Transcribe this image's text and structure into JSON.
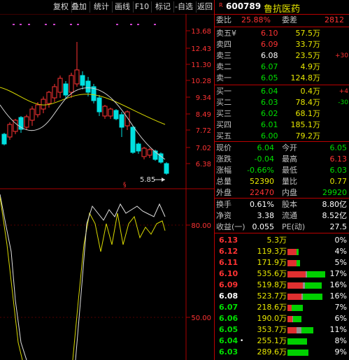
{
  "toolbar": {
    "buttons": [
      {
        "label": "复权"
      },
      {
        "label": "叠加"
      },
      {
        "label": "统计"
      },
      {
        "label": "画线"
      },
      {
        "label": "F10"
      },
      {
        "label": "标记"
      },
      {
        "label": "-自选"
      },
      {
        "label": "返回"
      }
    ]
  },
  "stock": {
    "badge": "R",
    "code": "600789",
    "name": "鲁抗医药"
  },
  "chart": {
    "price_ticks": [
      "13.68",
      "12.43",
      "11.30",
      "10.28",
      "9.34",
      "8.49",
      "7.72",
      "7.02",
      "6.38"
    ],
    "indicator_ticks": [
      "80.00",
      "50.00"
    ],
    "low_label": "5.85",
    "marker": "§"
  },
  "committee": {
    "ratio_label": "委比",
    "ratio_value": "25.88%",
    "diff_label": "委差",
    "diff_value": "2812"
  },
  "sell_orders": [
    {
      "label": "卖五¥",
      "price": "6.10",
      "volume": "57.5万",
      "change": ""
    },
    {
      "label": "卖四",
      "price": "6.09",
      "volume": "33.7万",
      "change": ""
    },
    {
      "label": "卖三",
      "price": "6.08",
      "volume": "23.5万",
      "change": "+30"
    },
    {
      "label": "卖二",
      "price": "6.07",
      "volume": "4.9万",
      "change": ""
    },
    {
      "label": "卖一",
      "price": "6.05",
      "volume": "124.8万",
      "change": ""
    }
  ],
  "buy_orders": [
    {
      "label": "买一",
      "price": "6.04",
      "volume": "0.4万",
      "change": "+4"
    },
    {
      "label": "买二",
      "price": "6.03",
      "volume": "78.4万",
      "change": "-30"
    },
    {
      "label": "买三",
      "price": "6.02",
      "volume": "68.1万",
      "change": ""
    },
    {
      "label": "买四",
      "price": "6.01",
      "volume": "185.1万",
      "change": ""
    },
    {
      "label": "买五",
      "price": "6.00",
      "volume": "79.2万",
      "change": ""
    }
  ],
  "quote": {
    "current_label": "现价",
    "current": "6.04",
    "open_label": "今开",
    "open": "6.05",
    "change_label": "涨跌",
    "change": "-0.04",
    "high_label": "最高",
    "high": "6.13",
    "pct_label": "涨幅",
    "pct": "-0.66%",
    "low_label": "最低",
    "low": "6.03",
    "volume_label": "总量",
    "volume": "52390",
    "ratio_label": "量比",
    "ratio": "0.77",
    "outer_label": "外盘",
    "outer": "22470",
    "inner_label": "内盘",
    "inner": "29920"
  },
  "fundamentals": {
    "turnover_label": "换手",
    "turnover": "0.61%",
    "capital_label": "股本",
    "capital": "8.80亿",
    "nav_label": "净资",
    "nav": "3.38",
    "float_label": "流通",
    "float": "8.52亿",
    "eps_label": "收益(一)",
    "eps": "0.055",
    "pe_label": "PE(动)",
    "pe": "27.5"
  },
  "distribution": [
    {
      "price": "6.13",
      "volume": "5.3万",
      "pct": "0%",
      "red": 0.0,
      "green": 0.0,
      "gray": 0.0
    },
    {
      "price": "6.12",
      "volume": "119.3万",
      "pct": "4%",
      "red": 0.22,
      "green": 0.05,
      "gray": 0.0
    },
    {
      "price": "6.11",
      "volume": "171.9万",
      "pct": "5%",
      "red": 0.22,
      "green": 0.08,
      "gray": 0.0
    },
    {
      "price": "6.10",
      "volume": "535.6万",
      "pct": "17%",
      "red": 0.45,
      "green": 0.45,
      "gray": 0.03
    },
    {
      "price": "6.09",
      "volume": "519.8万",
      "pct": "16%",
      "red": 0.38,
      "green": 0.42,
      "gray": 0.05
    },
    {
      "price": "6.08",
      "volume": "523.7万",
      "pct": "16%",
      "red": 0.35,
      "green": 0.48,
      "gray": 0.04
    },
    {
      "price": "6.07",
      "volume": "218.6万",
      "pct": "7%",
      "red": 0.1,
      "green": 0.28,
      "gray": 0.0
    },
    {
      "price": "6.06",
      "volume": "190.0万",
      "pct": "6%",
      "red": 0.12,
      "green": 0.2,
      "gray": 0.02
    },
    {
      "price": "6.05",
      "volume": "353.7万",
      "pct": "11%",
      "red": 0.22,
      "green": 0.3,
      "gray": 0.12
    },
    {
      "price": "6.04",
      "volume": "255.1万",
      "pct": "8%",
      "red": 0.0,
      "green": 0.48,
      "gray": 0.0
    },
    {
      "price": "6.03",
      "volume": "289.6万",
      "pct": "9%",
      "red": 0.0,
      "green": 0.52,
      "gray": 0.0
    }
  ],
  "distribution_current_price": "6.04",
  "colors": {
    "up": "#ff3333",
    "down": "#00e0e0",
    "ma1": "#d8d800",
    "ma2": "#d0d0d0",
    "panel_border": "#bb0000"
  }
}
